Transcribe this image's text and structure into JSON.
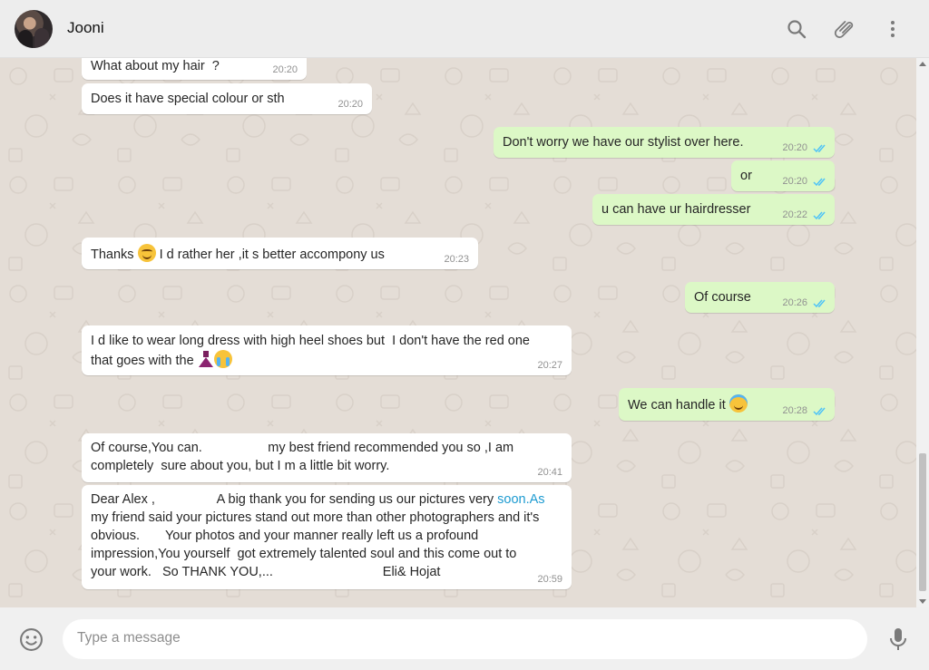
{
  "header": {
    "contact_name": "Jooni",
    "icons": [
      "search-icon",
      "attach-icon",
      "menu-icon"
    ]
  },
  "messages": [
    {
      "dir": "in",
      "lines": [
        "What about my hair  ?"
      ],
      "time": "20:20"
    },
    {
      "dir": "in",
      "lines": [
        "Does it have special colour or sth"
      ],
      "time": "20:20"
    },
    {
      "dir": "out",
      "lines": [
        "Don't worry we have our stylist over here."
      ],
      "time": "20:20",
      "status": "read"
    },
    {
      "dir": "out",
      "lines": [
        "or"
      ],
      "time": "20:20",
      "status": "read"
    },
    {
      "dir": "out",
      "lines": [
        "u can have ur hairdresser"
      ],
      "time": "20:22",
      "status": "read"
    },
    {
      "dir": "in",
      "text_before": "Thanks",
      "emoji": "smiling-face",
      "text_after": "I d rather her ,it s better accompony us",
      "time": "20:23"
    },
    {
      "dir": "out",
      "lines": [
        "Of course"
      ],
      "time": "20:26",
      "status": "read"
    },
    {
      "dir": "in",
      "line1": "I d like to wear long dress with high heel shoes but  I don't have the red one",
      "line2": "that goes with the",
      "emoji": [
        "dress",
        "crying-face"
      ],
      "time": "20:27"
    },
    {
      "dir": "out",
      "text": "We can handle it",
      "emoji": "smiling-face-with-halo",
      "time": "20:28",
      "status": "read"
    },
    {
      "dir": "in",
      "lines": [
        "Of course,You can.                  my best friend recommended you so ,I am",
        "completely  sure about you, but I m a little bit worry."
      ],
      "time": "20:41"
    },
    {
      "dir": "in",
      "line1_before": "Dear Alex ,                 A big thank you for sending us our pictures very ",
      "line1_link": "soon.As",
      "lines_rest": [
        "my friend said your pictures stand out more than other photographers and it's",
        "obvious.       Your photos and your manner really left us a profound",
        "impression,You yourself  got extremely talented soul and this come out to",
        "your work.   So THANK YOU,...                              Eli& Hojat"
      ],
      "time": "20:59"
    }
  ],
  "composer": {
    "placeholder": "Type a message",
    "icons": [
      "emoji-icon",
      "mic-icon"
    ]
  },
  "colors": {
    "header_bg": "#ededed",
    "chat_bg": "#e4ddd6",
    "incoming_bubble": "#ffffff",
    "outgoing_bubble": "#dcf8c6",
    "read_ticks": "#4fc3f7",
    "link": "#1d9bd1"
  }
}
